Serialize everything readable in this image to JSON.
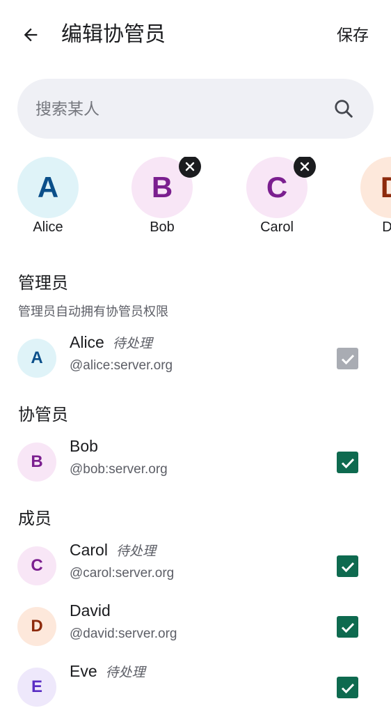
{
  "header": {
    "title": "编辑协管员",
    "save_label": "保存"
  },
  "search": {
    "placeholder": "搜索某人",
    "value": ""
  },
  "selected_chips": [
    {
      "initial": "A",
      "name": "Alice",
      "removable": false,
      "bg": "#dff3f8",
      "fg": "#0b4f8a"
    },
    {
      "initial": "B",
      "name": "Bob",
      "removable": true,
      "bg": "#f8e6f6",
      "fg": "#7b1f8f"
    },
    {
      "initial": "C",
      "name": "Carol",
      "removable": true,
      "bg": "#f8e6f6",
      "fg": "#7b1f8f"
    },
    {
      "initial": "D",
      "name": "Da",
      "removable": false,
      "bg": "#fde8db",
      "fg": "#8d2a0c"
    }
  ],
  "sections": {
    "admins": {
      "title": "管理员",
      "subtitle": "管理员自动拥有协管员权限"
    },
    "moderators": {
      "title": "协管员"
    },
    "members": {
      "title": "成员"
    }
  },
  "pending_label": "待处理",
  "users": [
    {
      "initial": "A",
      "name": "Alice",
      "handle": "@alice:server.org",
      "pending": true,
      "checked": true,
      "disabled": true,
      "bg": "#dff3f8",
      "fg": "#0b4f8a"
    },
    {
      "initial": "B",
      "name": "Bob",
      "handle": "@bob:server.org",
      "pending": false,
      "checked": true,
      "disabled": false,
      "bg": "#f8e6f6",
      "fg": "#7b1f8f"
    },
    {
      "initial": "C",
      "name": "Carol",
      "handle": "@carol:server.org",
      "pending": true,
      "checked": true,
      "disabled": false,
      "bg": "#f8e6f6",
      "fg": "#7b1f8f"
    },
    {
      "initial": "D",
      "name": "David",
      "handle": "@david:server.org",
      "pending": false,
      "checked": true,
      "disabled": false,
      "bg": "#fde8db",
      "fg": "#8d2a0c"
    },
    {
      "initial": "E",
      "name": "Eve",
      "handle": "",
      "pending": true,
      "checked": true,
      "disabled": false,
      "bg": "#eee8fb",
      "fg": "#5a2ec4"
    }
  ],
  "colors": {
    "accent": "#0e6a4f",
    "disabled_checkbox": "#a9acb3",
    "search_bg": "#eff0f5"
  }
}
